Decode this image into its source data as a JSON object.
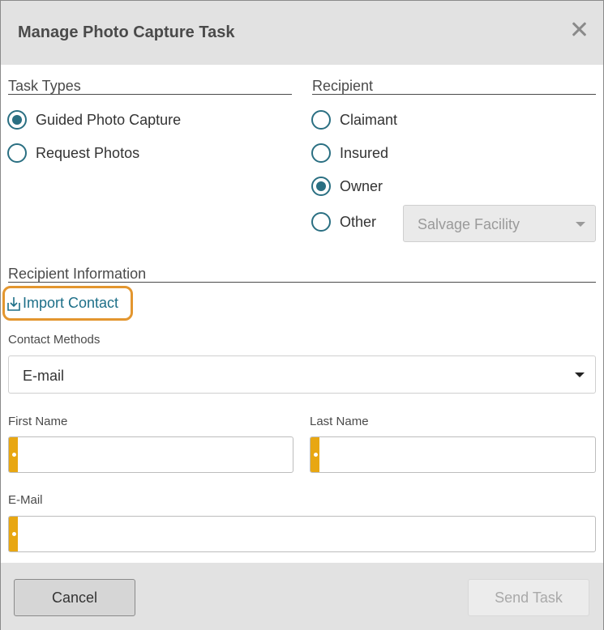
{
  "dialog": {
    "title": "Manage Photo Capture Task"
  },
  "task_types": {
    "heading": "Task Types",
    "options": [
      {
        "label": "Guided Photo Capture",
        "selected": true
      },
      {
        "label": "Request Photos",
        "selected": false
      }
    ]
  },
  "recipient": {
    "heading": "Recipient",
    "options": [
      {
        "label": "Claimant",
        "selected": false
      },
      {
        "label": "Insured",
        "selected": false
      },
      {
        "label": "Owner",
        "selected": true
      },
      {
        "label": "Other",
        "selected": false
      }
    ],
    "other_select_value": "Salvage Facility"
  },
  "recipient_info": {
    "heading": "Recipient Information",
    "import_contact_label": "Import Contact",
    "contact_methods_label": "Contact Methods",
    "contact_methods_value": "E-mail",
    "first_name_label": "First Name",
    "first_name_value": "",
    "last_name_label": "Last Name",
    "last_name_value": "",
    "email_label": "E-Mail",
    "email_value": ""
  },
  "footer": {
    "cancel_label": "Cancel",
    "send_label": "Send Task"
  },
  "colors": {
    "accent": "#2a6f82",
    "link": "#1d6f88",
    "highlight": "#e3962f",
    "required": "#e8a712"
  },
  "icons": {
    "close": "close-icon",
    "import": "import-icon",
    "dropdown": "chevron-down-icon"
  }
}
